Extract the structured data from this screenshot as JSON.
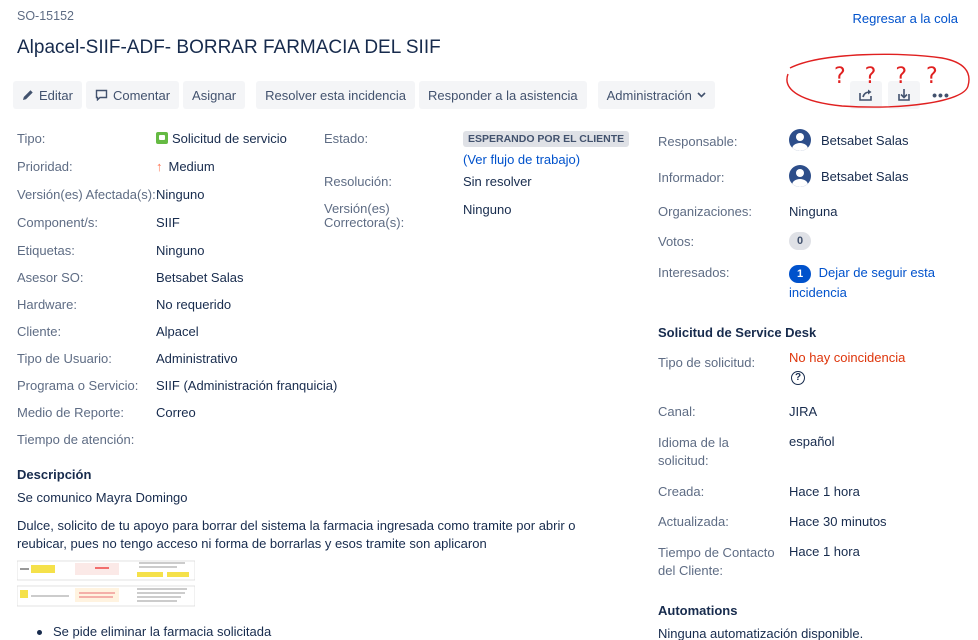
{
  "header": {
    "issue_key": "SO-15152",
    "back_link": "Regresar a la cola",
    "title": "Alpacel-SIIF-ADF- BORRAR FARMACIA DEL SIIF"
  },
  "toolbar": {
    "edit": "Editar",
    "comment": "Comentar",
    "assign": "Asignar",
    "resolve": "Resolver esta incidencia",
    "reply": "Responder a la asistencia",
    "admin": "Administración",
    "more": "•••"
  },
  "details": {
    "tipo_label": "Tipo:",
    "tipo": "Solicitud de servicio",
    "prioridad_label": "Prioridad:",
    "prioridad": "Medium",
    "version_label": "Versión(es) Afectada(s):",
    "version": "Ninguno",
    "component_label": "Component/s:",
    "component": "SIIF",
    "etiquetas_label": "Etiquetas:",
    "etiquetas": "Ninguno",
    "asesor_label": "Asesor SO:",
    "asesor": "Betsabet Salas",
    "hardware_label": "Hardware:",
    "hardware": "No requerido",
    "cliente_label": "Cliente:",
    "cliente": "Alpacel",
    "tipo_usuario_label": "Tipo de Usuario:",
    "tipo_usuario": "Administrativo",
    "programa_label": "Programa o Servicio:",
    "programa": "SIIF (Administración franquicia)",
    "medio_label": "Medio de Reporte:",
    "medio": "Correo",
    "tiempo_label": "Tiempo de atención:"
  },
  "status": {
    "estado_label": "Estado:",
    "estado": "ESPERANDO POR EL CLIENTE",
    "workflow_link": "(Ver flujo de trabajo)",
    "resolucion_label": "Resolución:",
    "resolucion": "Sin resolver",
    "version_corr_label_1": "Versión(es)",
    "version_corr_label_2": "Correctora(s):",
    "version_corr": "Ninguno"
  },
  "people": {
    "responsable_label": "Responsable:",
    "responsable": "Betsabet Salas",
    "informador_label": "Informador:",
    "informador": "Betsabet Salas",
    "org_label": "Organizaciones:",
    "org": "Ninguna",
    "votos_label": "Votos:",
    "votos": "0",
    "interesados_label": "Interesados:",
    "interesados_count": "1",
    "unwatch_1": "Dejar de seguir esta",
    "unwatch_2": "incidencia"
  },
  "service_desk": {
    "heading": "Solicitud de Service Desk",
    "tipo_label": "Tipo de solicitud:",
    "tipo": "No hay coincidencia",
    "canal_label": "Canal:",
    "canal": "JIRA",
    "idioma_label_1": "Idioma de la",
    "idioma_label_2": "solicitud:",
    "idioma": "español",
    "creada_label": "Creada:",
    "creada": "Hace 1 hora",
    "actualizada_label": "Actualizada:",
    "actualizada": "Hace 30 minutos",
    "contacto_label_1": "Tiempo de Contacto",
    "contacto_label_2": "del Cliente:",
    "contacto": "Hace 1 hora"
  },
  "automations": {
    "heading": "Automations",
    "text": "Ninguna automatización disponible."
  },
  "description": {
    "heading": "Descripción",
    "p1": "Se comunico Mayra Domingo",
    "p2a": "Dulce, solicito de tu apoyo para borrar del sistema la farmacia ingresada como tramite por abrir o",
    "p2b": "reubicar, pues no tengo acceso ni forma de borrarlas y esos tramite son aplicaron",
    "bullet": "Se pide eliminar la farmacia solicitada"
  },
  "annotation": {
    "marks": "? ? ? ?"
  },
  "colors": {
    "link": "#0052cc",
    "priority": "#ff7452",
    "request_type": "#65ba43",
    "no_match": "#de350b",
    "annotation": "#e02020"
  }
}
